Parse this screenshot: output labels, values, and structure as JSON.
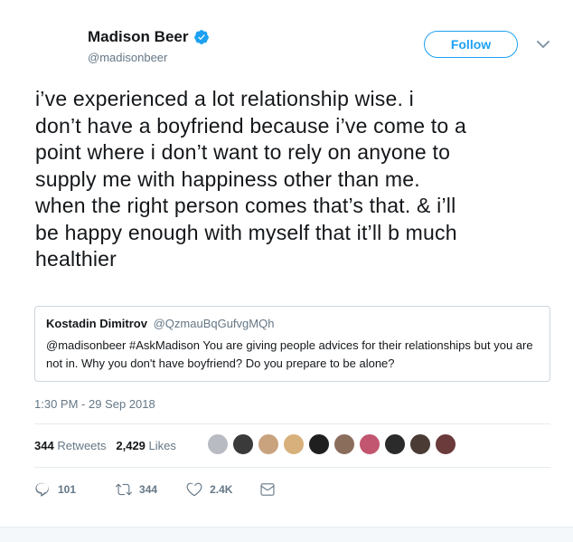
{
  "author": {
    "name": "Madison Beer",
    "handle": "@madisonbeer",
    "verified": true
  },
  "follow_label": "Follow",
  "tweet_text": "i’ve experienced a lot relationship wise. i\ndon’t have a boyfriend because i’ve come to a\npoint where i don’t want to rely on anyone to\nsupply me with happiness other than me.\nwhen the right person comes that’s that. & i’ll\nbe happy enough with myself that it’ll b much\nhealthier",
  "quoted": {
    "name": "Kostadin Dimitrov",
    "handle": "@QzmauBqGufvgMQh",
    "text": "@madisonbeer #AskMadison You are giving people advices for their relationships but you are not in.  Why you don't have boyfriend?  Do you prepare to be alone?"
  },
  "timestamp": "1:30 PM - 29 Sep 2018",
  "stats": {
    "retweets_count": "344",
    "retweets_label": "Retweets",
    "likes_count": "2,429",
    "likes_label": "Likes"
  },
  "liker_avatars": [
    "#b8bcc2",
    "#3a3a3a",
    "#c9a27e",
    "#d8b07c",
    "#1f1f1f",
    "#8b6d5c",
    "#c2556f",
    "#2b2b2b",
    "#4a3b34",
    "#6b3a3a"
  ],
  "actions": {
    "reply_count": "101",
    "retweet_count": "344",
    "like_count": "2.4K"
  },
  "colors": {
    "accent": "#1da1f2",
    "verified": "#1da1f2",
    "secondary_text": "#657786"
  }
}
